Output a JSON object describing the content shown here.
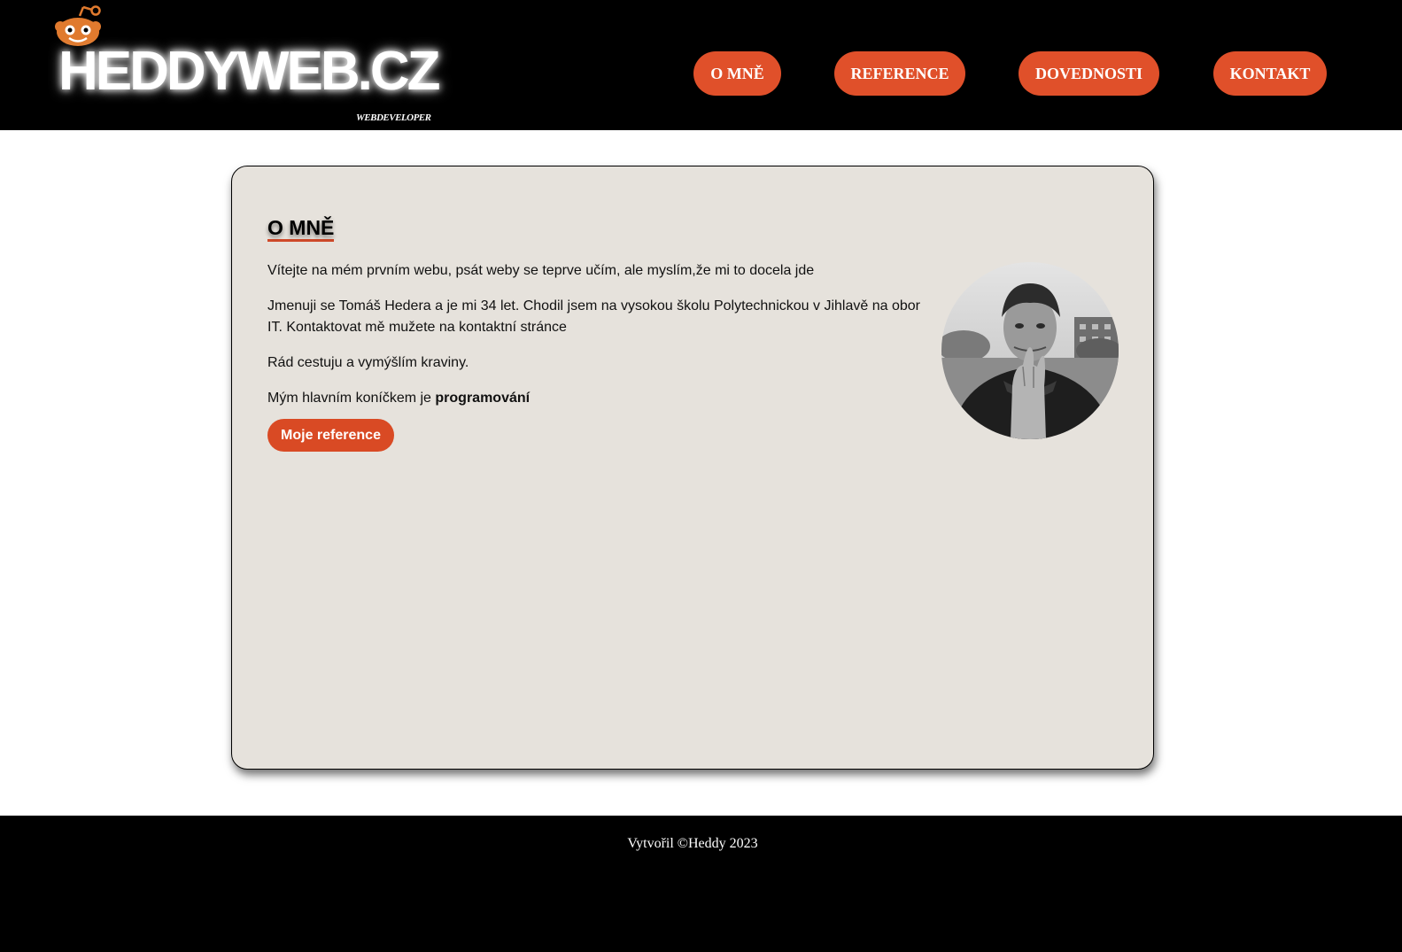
{
  "header": {
    "logo_text": "HEDDYWEB.CZ",
    "logo_subtitle": "WEBDEVELOPER",
    "logo_icon": "reddit-alien-mascot-icon",
    "nav": [
      {
        "label": "O MNĚ"
      },
      {
        "label": "REFERENCE"
      },
      {
        "label": "DOVEDNOSTI"
      },
      {
        "label": "KONTAKT"
      }
    ]
  },
  "main": {
    "title": "O MNĚ",
    "paragraphs": [
      "Vítejte na mém prvním webu, psát weby se teprve učím, ale myslím,že mi to docela jde",
      "Jmenuji se Tomáš Hedera a je mi 34 let. Chodil jsem na vysokou školu Polytechnickou v Jihlavě na obor IT. Kontaktovat mě mužete na kontaktní stránce",
      "Rád cestuju a vymýšlím kraviny."
    ],
    "hobby_prefix": "Mým hlavním koníčkem je ",
    "hobby_bold": "programování",
    "reference_button": "Moje reference",
    "photo": "profile-photo"
  },
  "footer": {
    "text": "Vytvořil ©Heddy 2023"
  },
  "colors": {
    "accent": "#e0502a",
    "header_bg": "#000000",
    "card_bg": "#e6e2dc"
  }
}
